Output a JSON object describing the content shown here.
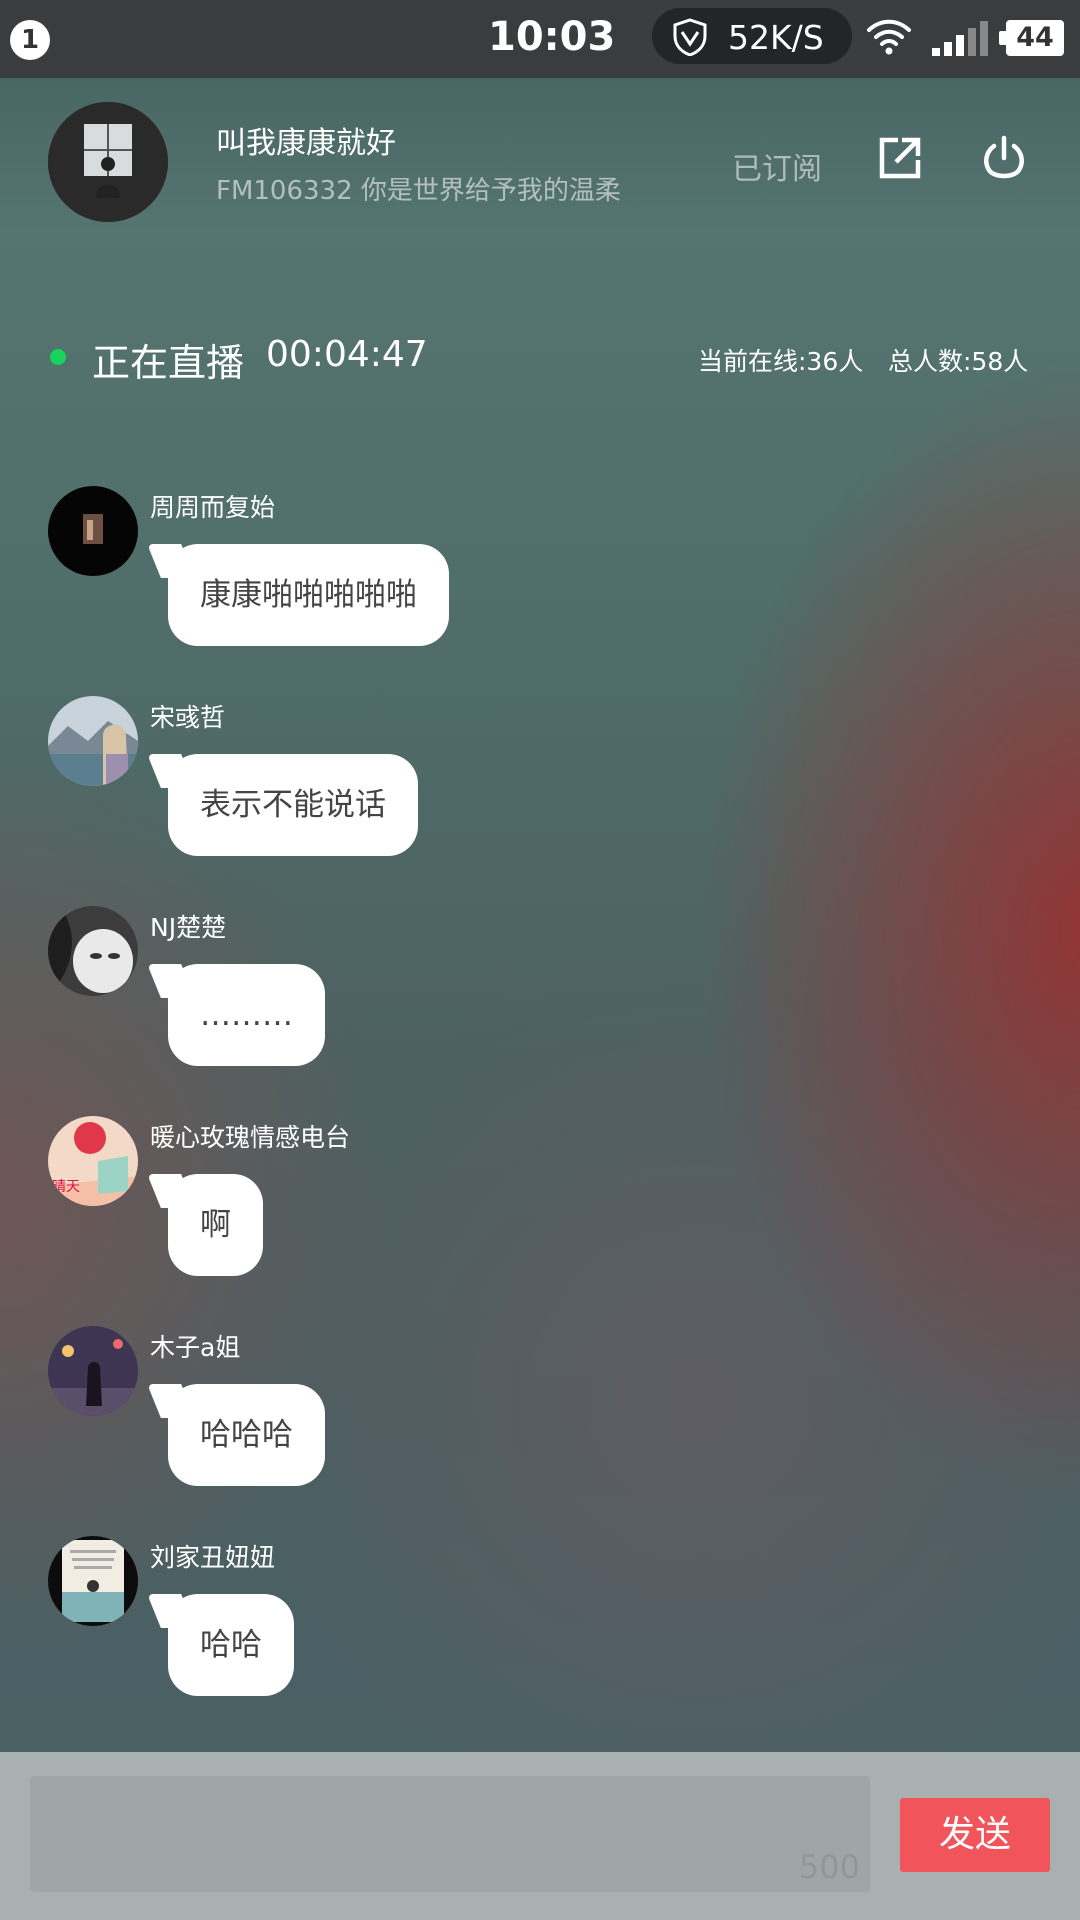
{
  "status_bar": {
    "notification_count": "1",
    "time": "10:03",
    "net_speed": "52K/S",
    "battery": "44",
    "icons": [
      "shield-icon",
      "wifi-icon",
      "signal-icon",
      "battery-icon"
    ]
  },
  "header": {
    "host_name": "叫我康康就好",
    "subtitle": "FM106332 你是世界给予我的温柔",
    "subscribed_label": "已订阅",
    "icons": [
      "share-icon",
      "power-icon"
    ]
  },
  "live": {
    "status_label": "正在直播",
    "elapsed": "00:04:47",
    "online": "当前在线:36人",
    "total": "总人数:58人",
    "status_color": "#17d25c"
  },
  "messages": [
    {
      "user": "周周而复始",
      "text": "康康啪啪啪啪啪"
    },
    {
      "user": "宋彧哲",
      "text": "表示不能说话"
    },
    {
      "user": "NJ楚楚",
      "text": "………"
    },
    {
      "user": "暖心玫瑰情感电台",
      "text": "啊"
    },
    {
      "user": "木子a姐",
      "text": "哈哈哈"
    },
    {
      "user": "刘家丑妞妞",
      "text": "哈哈"
    }
  ],
  "composer": {
    "input_value": "",
    "char_limit": "500",
    "send_label": "发送",
    "send_color": "#f2545b"
  }
}
